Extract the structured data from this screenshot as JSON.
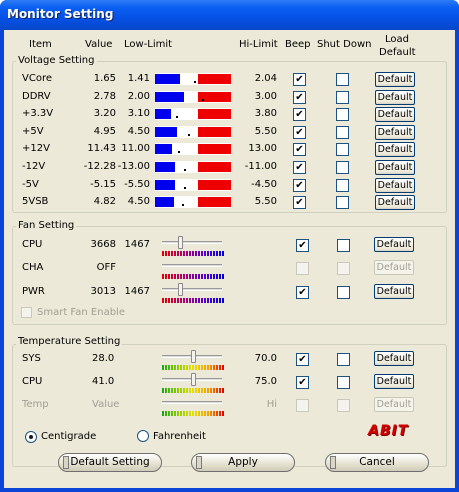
{
  "window": {
    "title": "Monitor Setting"
  },
  "columns": {
    "item": "Item",
    "value": "Value",
    "low_limit": "Low-Limit",
    "hi_limit": "Hi-Limit",
    "beep": "Beep",
    "shut_down": "Shut Down",
    "load_default_1": "Load",
    "load_default_2": "Default"
  },
  "voltage": {
    "title": "Voltage Setting",
    "rows": [
      {
        "name": "VCore",
        "value": "1.65",
        "low": "1.41",
        "hi": "2.04",
        "beep": "✔",
        "shutdown": "",
        "button": "Default",
        "level": 0.62
      },
      {
        "name": "DDRV",
        "value": "2.78",
        "low": "2.00",
        "hi": "3.00",
        "beep": "✔",
        "shutdown": "",
        "button": "Default",
        "level": 0.78
      },
      {
        "name": "+3.3V",
        "value": "3.20",
        "low": "3.10",
        "hi": "3.80",
        "beep": "✔",
        "shutdown": "",
        "button": "Default",
        "level": 0.14
      },
      {
        "name": "+5V",
        "value": "4.95",
        "low": "4.50",
        "hi": "5.50",
        "beep": "✔",
        "shutdown": "",
        "button": "Default",
        "level": 0.45
      },
      {
        "name": "+12V",
        "value": "11.43",
        "low": "11.00",
        "hi": "13.00",
        "beep": "✔",
        "shutdown": "",
        "button": "Default",
        "level": 0.21
      },
      {
        "name": "-12V",
        "value": "-12.28",
        "low": "-13.00",
        "hi": "-11.00",
        "beep": "✔",
        "shutdown": "",
        "button": "Default",
        "level": 0.36
      },
      {
        "name": "-5V",
        "value": "-5.15",
        "low": "-5.50",
        "hi": "-4.50",
        "beep": "✔",
        "shutdown": "",
        "button": "Default",
        "level": 0.35
      },
      {
        "name": "5VSB",
        "value": "4.82",
        "low": "4.50",
        "hi": "5.50",
        "beep": "✔",
        "shutdown": "",
        "button": "Default",
        "level": 0.32
      }
    ]
  },
  "fan": {
    "title": "Fan Setting",
    "rows": [
      {
        "name": "CPU",
        "value": "3668",
        "low": "1467",
        "beep": "✔",
        "shutdown": "",
        "button": "Default",
        "enabled": true,
        "slider": 0.28
      },
      {
        "name": "CHA",
        "value": "OFF",
        "low": "",
        "beep": "",
        "shutdown": "",
        "button": "Default",
        "enabled": false,
        "slider": 0.0
      },
      {
        "name": "PWR",
        "value": "3013",
        "low": "1467",
        "beep": "✔",
        "shutdown": "",
        "button": "Default",
        "enabled": true,
        "slider": 0.28
      }
    ],
    "smart_fan_label": "Smart Fan Enable"
  },
  "temperature": {
    "title": "Temperature Setting",
    "rows": [
      {
        "name": "SYS",
        "value": "28.0",
        "hi": "70.0",
        "beep": "✔",
        "shutdown": "",
        "button": "Default",
        "enabled": true,
        "slider": 0.5
      },
      {
        "name": "CPU",
        "value": "41.0",
        "hi": "75.0",
        "beep": "✔",
        "shutdown": "",
        "button": "Default",
        "enabled": true,
        "slider": 0.5
      },
      {
        "name": "Temp",
        "value": "Value",
        "hi": "Hi",
        "beep": "",
        "shutdown": "",
        "button": "Default",
        "enabled": false,
        "slider": 0.0
      }
    ]
  },
  "units": {
    "centigrade": "Centigrade",
    "fahrenheit": "Fahrenheit",
    "selected": "centigrade"
  },
  "logo": "ABIT",
  "footer": {
    "default_setting": "Default Setting",
    "apply": "Apply",
    "cancel": "Cancel"
  },
  "colors": {
    "title_bar": "#0a5ff2",
    "face": "#ece9d8",
    "volt_low": "#0000ee",
    "volt_high": "#ee0000"
  }
}
